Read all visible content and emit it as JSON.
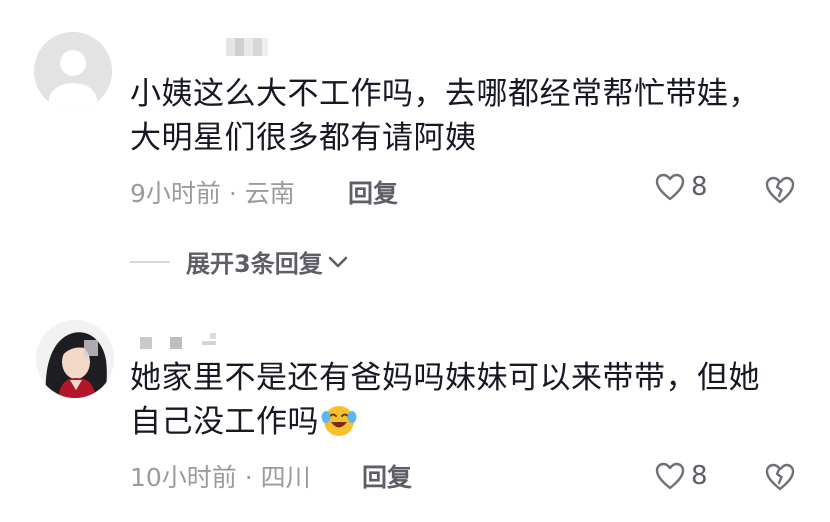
{
  "comments": [
    {
      "text": "小姨这么大不工作吗，去哪都经常帮忙带娃，\n大明星们很多都有请阿姨",
      "meta": "9小时前 · 云南",
      "reply_label": "回复",
      "likes": "8",
      "avatar_icon": "default-user-icon"
    },
    {
      "text_before_emoji": "她家里不是还有爸妈吗妹妹可以来带带，但她\n自己没工作吗",
      "emoji_icon": "crying-laughing-emoji-icon",
      "meta": "10小时前 · 四川",
      "reply_label": "回复",
      "likes": "8",
      "avatar_icon": "anime-girl-avatar-icon"
    }
  ],
  "expand_replies": {
    "label": "展开3条回复"
  },
  "colors": {
    "text": "#161823",
    "meta": "#9a9a9f",
    "action": "#5d5e66"
  }
}
